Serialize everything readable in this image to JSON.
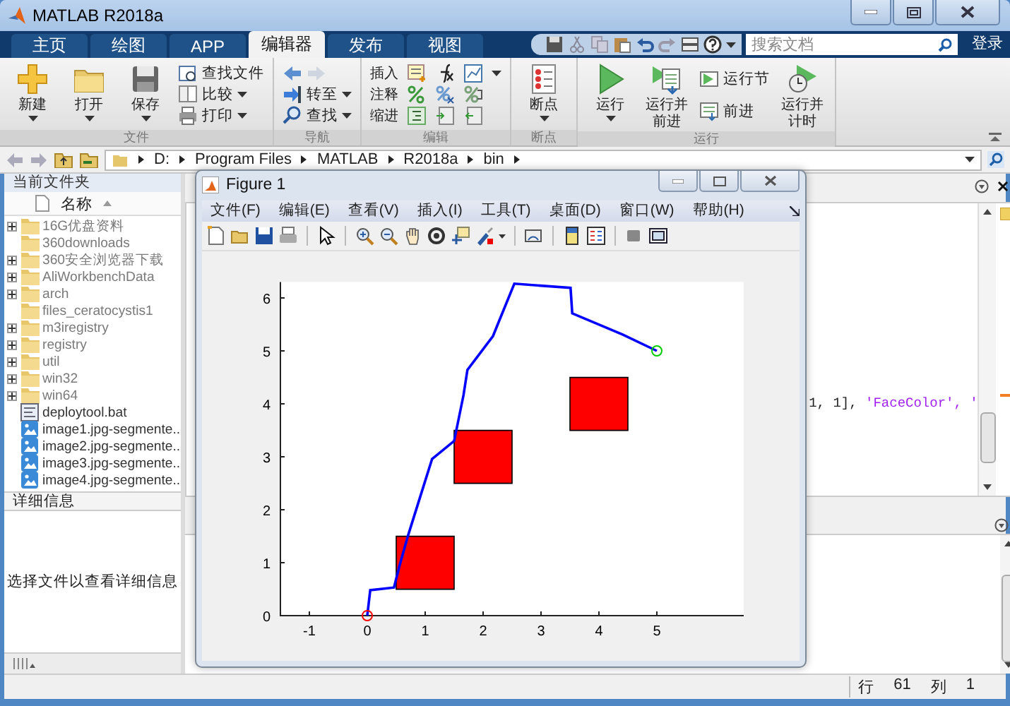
{
  "window": {
    "title": "MATLAB R2018a"
  },
  "tabs": [
    {
      "label": "主页",
      "selected": false
    },
    {
      "label": "绘图",
      "selected": false
    },
    {
      "label": "APP",
      "selected": false
    },
    {
      "label": "编辑器",
      "selected": true
    },
    {
      "label": "发布",
      "selected": false
    },
    {
      "label": "视图",
      "selected": false
    }
  ],
  "search": {
    "placeholder": "搜索文档"
  },
  "login": "登录",
  "ribbon": {
    "groups": [
      {
        "label": "文件",
        "items": [
          {
            "kind": "large",
            "label": "新建",
            "dropdown": true
          },
          {
            "kind": "large",
            "label": "打开",
            "dropdown": true
          },
          {
            "kind": "large",
            "label": "保存",
            "dropdown": true
          },
          {
            "kind": "stack",
            "rows": [
              {
                "label": "查找文件",
                "dropdown": false
              },
              {
                "label": "比较",
                "dropdown": true
              },
              {
                "label": "打印",
                "dropdown": true
              }
            ]
          }
        ]
      },
      {
        "label": "导航",
        "items": [
          {
            "kind": "stack",
            "rows": [
              {
                "kind": "arrows"
              },
              {
                "label": "转至",
                "dropdown": true
              },
              {
                "label": "查找",
                "dropdown": true
              }
            ]
          }
        ]
      },
      {
        "label": "编辑",
        "items": [
          {
            "kind": "tools",
            "rows": [
              {
                "label": "插入",
                "dropdown": true
              },
              {
                "label": "注释",
                "dropdown": false
              },
              {
                "label": "缩进",
                "dropdown": false
              }
            ]
          }
        ]
      },
      {
        "label": "断点",
        "items": [
          {
            "kind": "large",
            "label": "断点",
            "dropdown": true
          }
        ]
      },
      {
        "label": "运行",
        "items": [
          {
            "kind": "large",
            "label": "运行",
            "dropdown": true
          },
          {
            "kind": "large",
            "label": "运行并前进",
            "dropdown": false
          },
          {
            "kind": "stack",
            "rows": [
              {
                "label": "运行节",
                "dropdown": false
              },
              {
                "label": "前进",
                "dropdown": false
              }
            ]
          },
          {
            "kind": "large",
            "label": "运行并计时",
            "dropdown": false
          }
        ]
      }
    ]
  },
  "address": {
    "path": [
      "D:",
      "Program Files",
      "MATLAB",
      "R2018a",
      "bin"
    ]
  },
  "current_folder": {
    "title": "当前文件夹",
    "column": "名称",
    "items": [
      {
        "name": "16G优盘资料",
        "kind": "folder",
        "expandable": true
      },
      {
        "name": "360downloads",
        "kind": "folder",
        "expandable": false
      },
      {
        "name": "360安全浏览器下载",
        "kind": "folder",
        "expandable": true
      },
      {
        "name": "AliWorkbenchData",
        "kind": "folder",
        "expandable": true
      },
      {
        "name": "arch",
        "kind": "folder",
        "expandable": true
      },
      {
        "name": "files_ceratocystis1",
        "kind": "folder",
        "expandable": false
      },
      {
        "name": "m3iregistry",
        "kind": "folder",
        "expandable": true
      },
      {
        "name": "registry",
        "kind": "folder",
        "expandable": true
      },
      {
        "name": "util",
        "kind": "folder",
        "expandable": true
      },
      {
        "name": "win32",
        "kind": "folder",
        "expandable": true
      },
      {
        "name": "win64",
        "kind": "folder",
        "expandable": true
      },
      {
        "name": "deploytool.bat",
        "kind": "script",
        "expandable": false
      },
      {
        "name": "image1.jpg-segmente..",
        "kind": "image",
        "expandable": false
      },
      {
        "name": "image2.jpg-segmente..",
        "kind": "image",
        "expandable": false
      },
      {
        "name": "image3.jpg-segmente..",
        "kind": "image",
        "expandable": false
      },
      {
        "name": "image4.jpg-segmente..",
        "kind": "image",
        "expandable": false
      }
    ]
  },
  "details": {
    "title": "详细信息",
    "message": "选择文件以查看详细信息"
  },
  "editor": {
    "code": [
      {
        "text": "1, 1], ",
        "kind": "plain"
      },
      {
        "text": "'FaceColor', '",
        "kind": "string"
      }
    ]
  },
  "status_bar": {
    "row_label": "行",
    "row": "61",
    "col_label": "列",
    "col": "1"
  },
  "figure": {
    "title": "Figure 1",
    "menus": [
      "文件(F)",
      "编辑(E)",
      "查看(V)",
      "插入(I)",
      "工具(T)",
      "桌面(D)",
      "窗口(W)",
      "帮助(H)"
    ],
    "chart_data": {
      "type": "line",
      "x": [
        0,
        0.05,
        0.46,
        0.56,
        0.7,
        0.93,
        1.12,
        1.5,
        1.66,
        1.73,
        2.17,
        2.27,
        2.54,
        3.51,
        3.54,
        4.41,
        5,
        0.5,
        1.5,
        1.5,
        0.5,
        0.5,
        1.5,
        2.5,
        2.5,
        1.5,
        1.5,
        3.5,
        4.5,
        4.5,
        3.5,
        3.5
      ],
      "series": [
        {
          "color": "#0000ff",
          "values": [
            0,
            0.48,
            0.53,
            0.96,
            1.5,
            2.3,
            2.96,
            3.3,
            4.16,
            4.64,
            5.28,
            5.55,
            6.27,
            6.19,
            5.71,
            5.31,
            5,
            null,
            null,
            null,
            null,
            null,
            null,
            null,
            null,
            null,
            null,
            null,
            null,
            null,
            null,
            null
          ]
        },
        {
          "type": "area",
          "color": "#ff0000",
          "values": [
            null,
            null,
            null,
            null,
            null,
            null,
            null,
            null,
            null,
            null,
            null,
            null,
            null,
            null,
            null,
            null,
            null,
            0.5,
            0.5,
            1.5,
            1.5,
            0.5,
            null,
            null,
            null,
            null,
            null,
            null,
            null,
            null,
            null,
            null
          ]
        },
        {
          "type": "area",
          "color": "#ff0000",
          "values": [
            null,
            null,
            null,
            null,
            null,
            null,
            null,
            null,
            null,
            null,
            null,
            null,
            null,
            null,
            null,
            null,
            null,
            null,
            null,
            null,
            null,
            null,
            2.5,
            2.5,
            3.5,
            3.5,
            2.5,
            null,
            null,
            null,
            null,
            null
          ]
        },
        {
          "type": "area",
          "color": "#ff0000",
          "values": [
            null,
            null,
            null,
            null,
            null,
            null,
            null,
            null,
            null,
            null,
            null,
            null,
            null,
            null,
            null,
            null,
            null,
            null,
            null,
            null,
            null,
            null,
            null,
            null,
            null,
            null,
            null,
            3.5,
            3.5,
            4.5,
            4.5,
            3.5
          ]
        },
        {
          "color": "#ff0000",
          "marker": "circle",
          "values": [
            0,
            null,
            null,
            null,
            null,
            null,
            null,
            null,
            null,
            null,
            null,
            null,
            null,
            null,
            null,
            null,
            null,
            null,
            null,
            null,
            null,
            null,
            null,
            null,
            null,
            null,
            null,
            null,
            null,
            null,
            null,
            null
          ]
        },
        {
          "color": "#00cc00",
          "marker": "circle",
          "values": [
            null,
            null,
            null,
            null,
            null,
            null,
            null,
            null,
            null,
            null,
            null,
            null,
            null,
            null,
            null,
            null,
            5,
            null,
            null,
            null,
            null,
            null,
            null,
            null,
            null,
            null,
            null,
            null,
            null,
            null,
            null,
            null
          ]
        }
      ],
      "xlim": [
        -1.5,
        6.5
      ],
      "ylim": [
        0,
        6.3
      ],
      "xticks": [
        -1,
        0,
        1,
        2,
        3,
        4,
        5
      ],
      "yticks": [
        0,
        1,
        2,
        3,
        4,
        5,
        6
      ]
    }
  }
}
